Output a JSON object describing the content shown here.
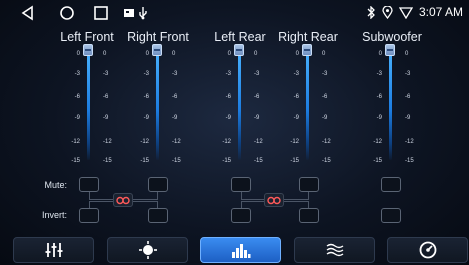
{
  "status": {
    "time": "3:07 AM"
  },
  "channels": [
    {
      "name": "Left Front"
    },
    {
      "name": "Right Front"
    },
    {
      "name": "Left Rear"
    },
    {
      "name": "Right Rear"
    },
    {
      "name": "Subwoofer"
    }
  ],
  "scale": [
    "0",
    "-3",
    "-6",
    "-9",
    "-12",
    "-15"
  ],
  "labels": {
    "mute": "Mute:",
    "invert": "Invert:"
  },
  "tabs": [
    {
      "icon": "sliders-icon"
    },
    {
      "icon": "target-icon"
    },
    {
      "icon": "equalizer-bars-icon"
    },
    {
      "icon": "waves-icon"
    },
    {
      "icon": "gauge-icon"
    }
  ],
  "colors": {
    "accent": "#1f8cff",
    "active_tab": "#2f7fe6"
  }
}
